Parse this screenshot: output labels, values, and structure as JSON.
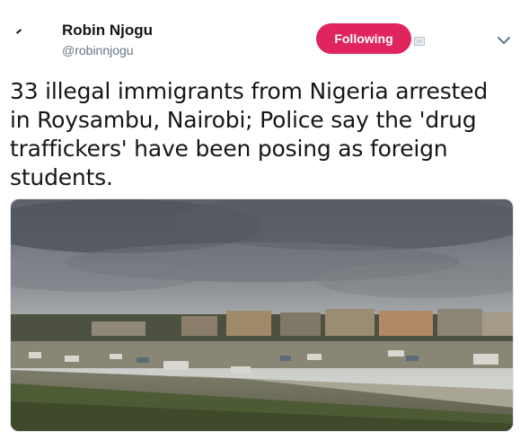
{
  "tweet": {
    "author_name": "Robin Njogu",
    "author_handle": "@robinnjogu",
    "follow_label": "Following",
    "text": "33 illegal immigrants from Nigeria arrested in Roysambu, Nairobi; Police say the 'drug traffickers' have been posing as foreign students."
  },
  "colors": {
    "follow_button": "#e0245e",
    "name_text": "#14171a",
    "handle_text": "#657786",
    "chevron": "#657786"
  },
  "icons": {
    "avatar": "avatar-image",
    "badge": "badge-icon",
    "more": "chevron-down-icon"
  }
}
